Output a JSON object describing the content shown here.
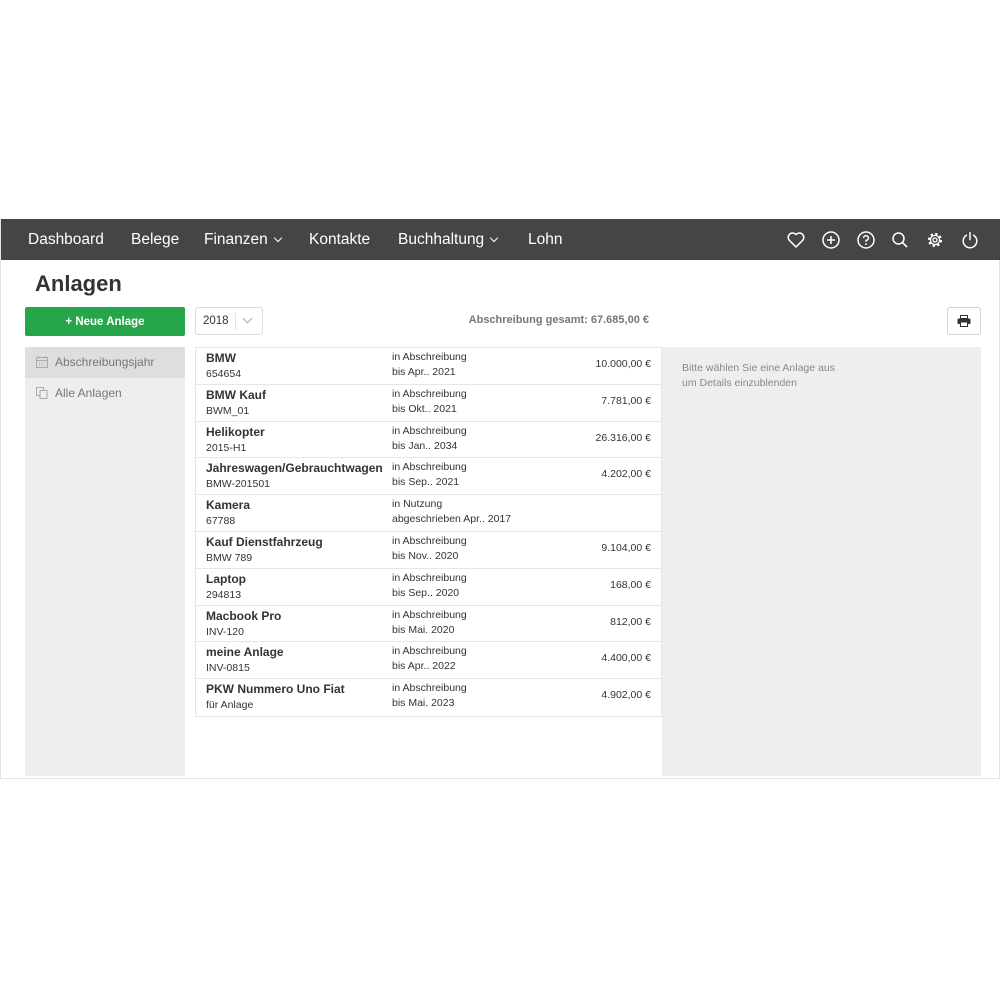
{
  "nav": {
    "items": [
      {
        "label": "Dashboard",
        "dropdown": false
      },
      {
        "label": "Belege",
        "dropdown": false
      },
      {
        "label": "Finanzen",
        "dropdown": true
      },
      {
        "label": "Kontakte",
        "dropdown": false
      },
      {
        "label": "Buchhaltung",
        "dropdown": true
      },
      {
        "label": "Lohn",
        "dropdown": false
      }
    ],
    "icons": [
      "heart-icon",
      "plus-circle-icon",
      "help-circle-icon",
      "search-icon",
      "gear-icon",
      "power-icon"
    ]
  },
  "page": {
    "title": "Anlagen",
    "new_button_label": "+ Neue Anlage",
    "year": "2018",
    "total_label": "Abschreibung gesamt: 67.685,00 €"
  },
  "sidebar": {
    "items": [
      {
        "label": "Abschreibungsjahr",
        "icon": "calendar-icon",
        "active": true
      },
      {
        "label": "Alle Anlagen",
        "icon": "copy-icon",
        "active": false
      }
    ]
  },
  "assets": [
    {
      "name": "BMW",
      "code": "654654",
      "status": "in Abschreibung",
      "status_detail": "bis Apr.. 2021",
      "amount": "10.000,00 €"
    },
    {
      "name": "BMW Kauf",
      "code": "BWM_01",
      "status": "in Abschreibung",
      "status_detail": "bis Okt.. 2021",
      "amount": "7.781,00 €"
    },
    {
      "name": "Helikopter",
      "code": "2015-H1",
      "status": "in Abschreibung",
      "status_detail": "bis Jan.. 2034",
      "amount": "26.316,00 €"
    },
    {
      "name": "Jahreswagen/Gebrauchtwagen",
      "code": "BMW-201501",
      "status": "in Abschreibung",
      "status_detail": "bis Sep.. 2021",
      "amount": "4.202,00 €"
    },
    {
      "name": "Kamera",
      "code": "67788",
      "status": "in Nutzung",
      "status_detail": "abgeschrieben Apr.. 2017",
      "amount": ""
    },
    {
      "name": "Kauf Dienstfahrzeug",
      "code": "BMW 789",
      "status": "in Abschreibung",
      "status_detail": "bis Nov.. 2020",
      "amount": "9.104,00 €"
    },
    {
      "name": "Laptop",
      "code": "294813",
      "status": "in Abschreibung",
      "status_detail": "bis Sep.. 2020",
      "amount": "168,00 €"
    },
    {
      "name": "Macbook Pro",
      "code": "INV-120",
      "status": "in Abschreibung",
      "status_detail": "bis Mai. 2020",
      "amount": "812,00 €"
    },
    {
      "name": "meine Anlage",
      "code": "INV-0815",
      "status": "in Abschreibung",
      "status_detail": "bis Apr.. 2022",
      "amount": "4.400,00 €"
    },
    {
      "name": "PKW Nummero Uno Fiat",
      "code": "für Anlage",
      "status": "in Abschreibung",
      "status_detail": "bis Mai. 2023",
      "amount": "4.902,00 €"
    }
  ],
  "details": {
    "hint": "Bitte wählen Sie eine Anlage aus um Details einzublenden"
  },
  "colors": {
    "nav_bg": "#454545",
    "primary_button": "#27a54a",
    "panel_bg": "#eeeeee"
  }
}
